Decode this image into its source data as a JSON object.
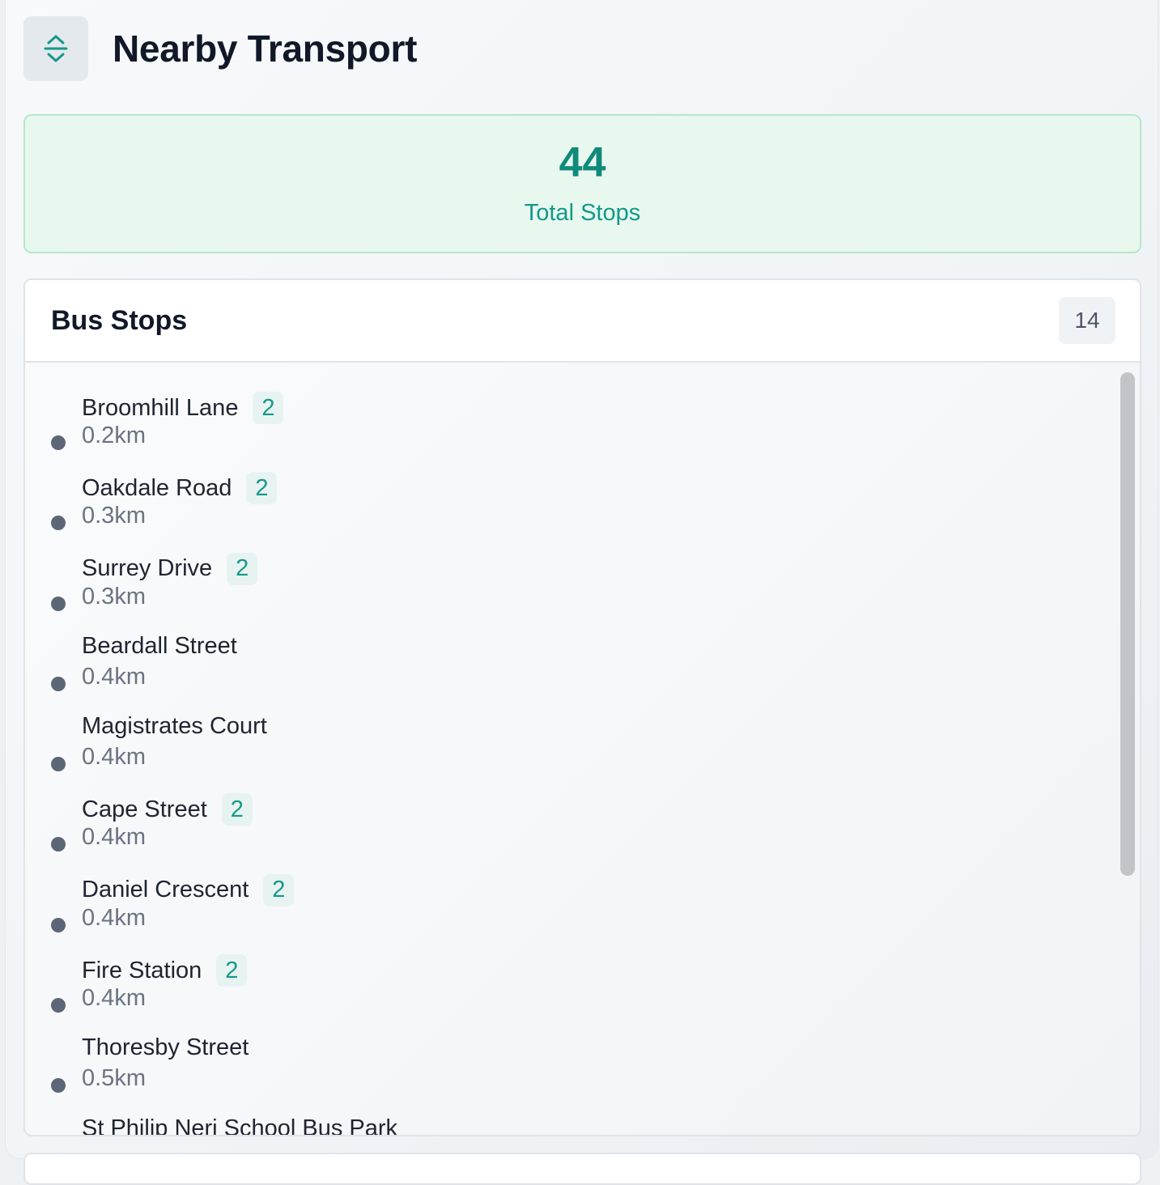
{
  "header": {
    "title": "Nearby Transport",
    "collapse_icon": "chevron-up-down-icon",
    "accent_color": "#11998a"
  },
  "summary": {
    "total": "44",
    "label": "Total Stops"
  },
  "bus_stops": {
    "title": "Bus Stops",
    "count": "14",
    "items": [
      {
        "name": "Broomhill Lane",
        "badge": "2",
        "distance": "0.2km"
      },
      {
        "name": "Oakdale Road",
        "badge": "2",
        "distance": "0.3km"
      },
      {
        "name": "Surrey Drive",
        "badge": "2",
        "distance": "0.3km"
      },
      {
        "name": "Beardall Street",
        "badge": null,
        "distance": "0.4km"
      },
      {
        "name": "Magistrates Court",
        "badge": null,
        "distance": "0.4km"
      },
      {
        "name": "Cape Street",
        "badge": "2",
        "distance": "0.4km"
      },
      {
        "name": "Daniel Crescent",
        "badge": "2",
        "distance": "0.4km"
      },
      {
        "name": "Fire Station",
        "badge": "2",
        "distance": "0.4km"
      },
      {
        "name": "Thoresby Street",
        "badge": null,
        "distance": "0.5km"
      },
      {
        "name": "St Philip Neri School Bus Park",
        "badge": null,
        "distance": null
      }
    ]
  }
}
